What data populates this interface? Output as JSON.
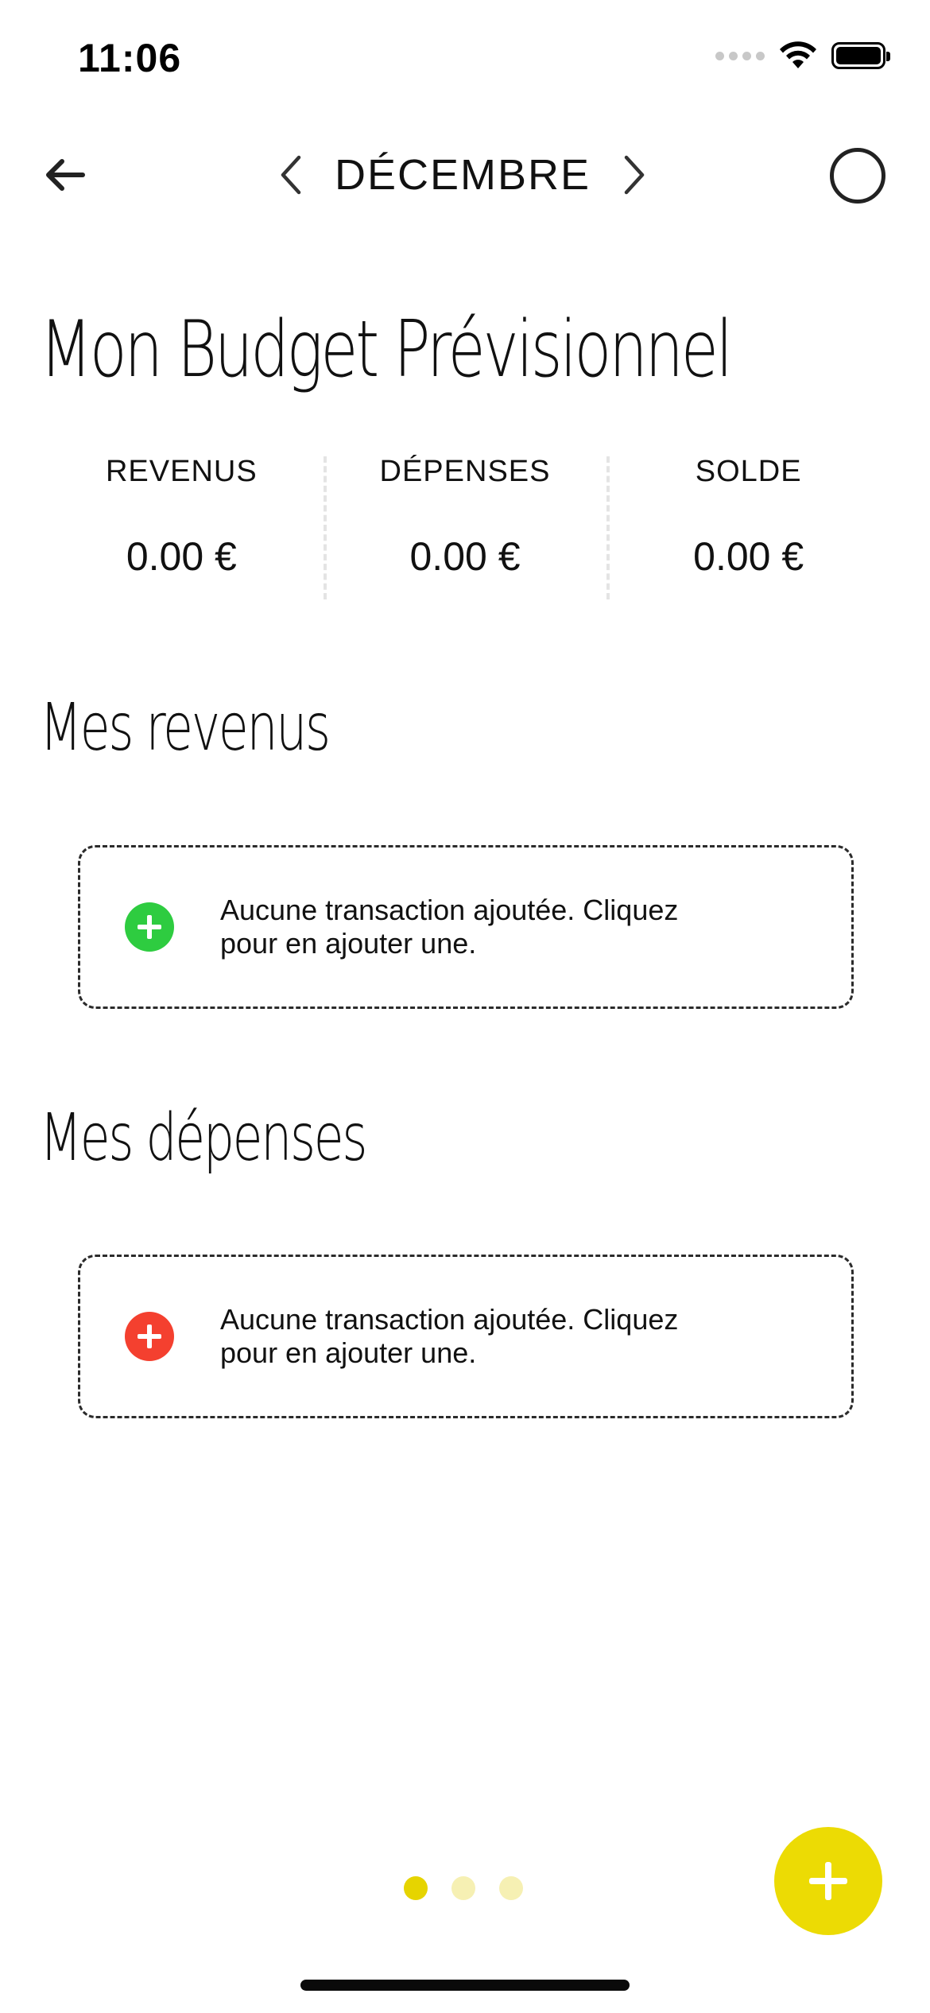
{
  "status_bar": {
    "time": "11:06",
    "icons": [
      "cellular-signal-icon",
      "wifi-icon",
      "battery-icon"
    ]
  },
  "nav": {
    "back_icon": "arrow-left-icon",
    "prev_icon": "chevron-left-icon",
    "month": "DÉCEMBRE",
    "next_icon": "chevron-right-icon",
    "circle_icon": "circle-outline-icon"
  },
  "page_title": "Mon Budget Prévisionnel",
  "summary": [
    {
      "label": "REVENUS",
      "value": "0.00 €"
    },
    {
      "label": "DÉPENSES",
      "value": "0.00 €"
    },
    {
      "label": "SOLDE",
      "value": "0.00 €"
    }
  ],
  "income": {
    "title": "Mes revenus",
    "empty_text": "Aucune transaction ajoutée. Cliquez pour en ajouter une.",
    "icon": "plus-circle-icon",
    "icon_color": "#2ecc40"
  },
  "expenses": {
    "title": "Mes dépenses",
    "empty_text": "Aucune transaction ajoutée. Cliquez pour en ajouter une.",
    "icon": "plus-circle-icon",
    "icon_color": "#f4402f"
  },
  "pager": {
    "count": 3,
    "active_index": 0,
    "active_color": "#e6d400",
    "inactive_color": "#f6f0b3"
  },
  "fab": {
    "icon": "plus-icon",
    "color": "#ecdb04"
  }
}
